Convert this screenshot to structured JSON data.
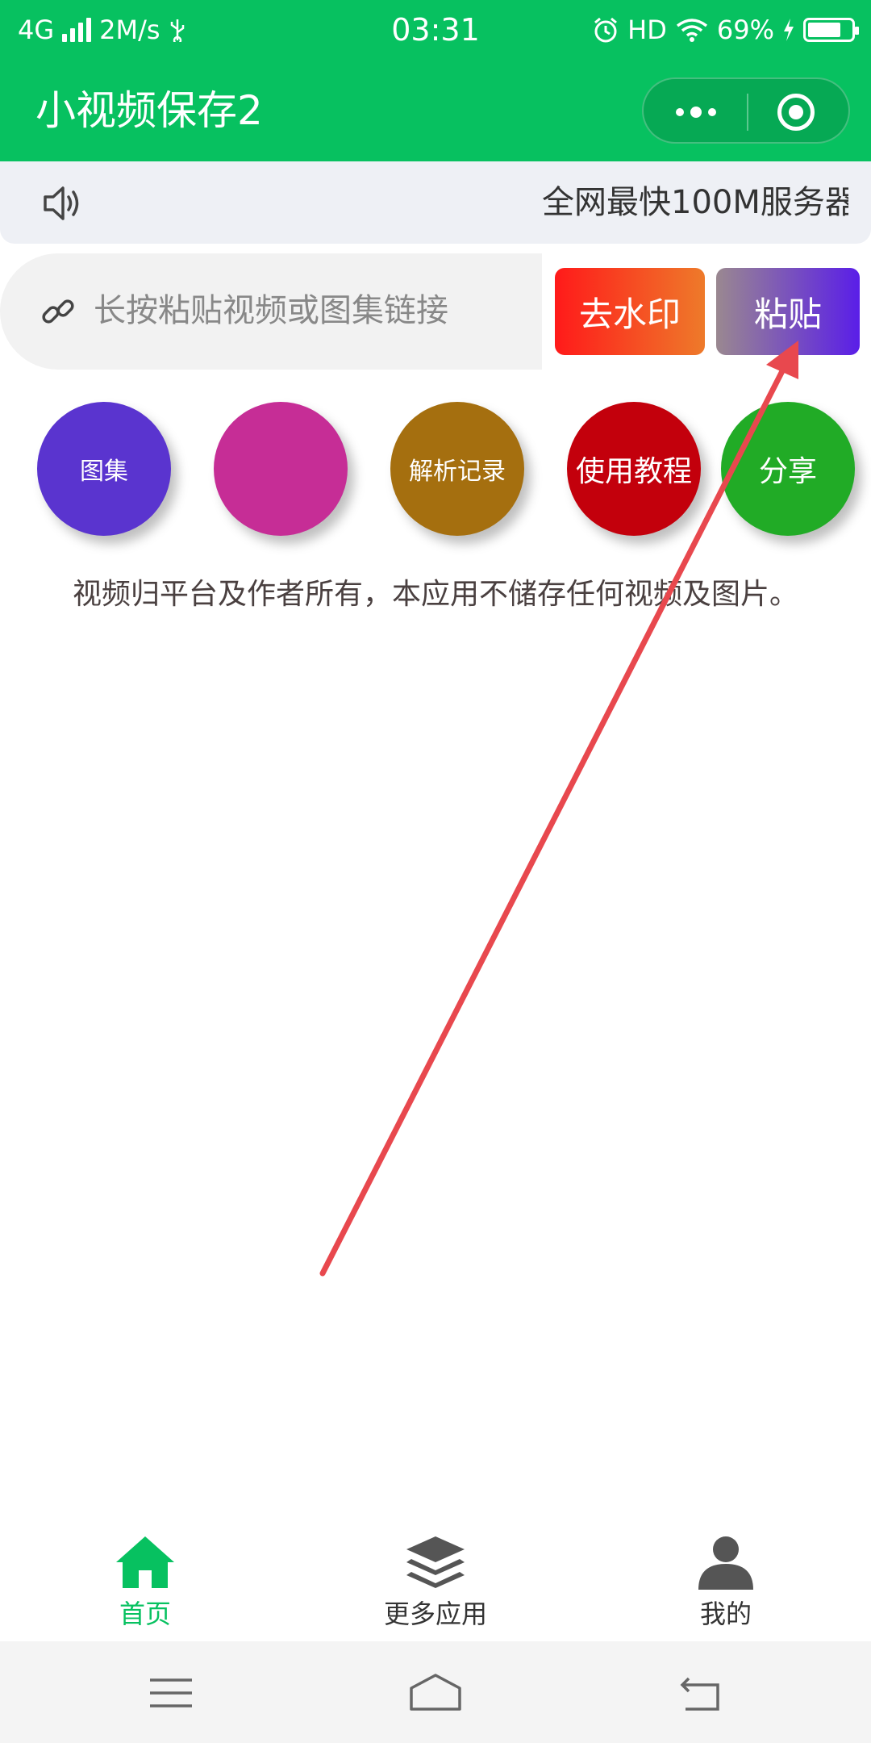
{
  "status_bar": {
    "network": "4G",
    "speed": "2M/s",
    "time": "03:31",
    "hd": "HD",
    "battery": "69%"
  },
  "title_bar": {
    "title": "小视频保存2",
    "more_icon": "more-dots-icon",
    "close_icon": "target-icon"
  },
  "notice": {
    "icon": "speaker-icon",
    "text": "全网最快100M服务器"
  },
  "input": {
    "icon": "link-icon",
    "placeholder": "长按粘贴视频或图集链接"
  },
  "buttons": {
    "remove_watermark": "去水印",
    "paste": "粘贴"
  },
  "circles": [
    {
      "label": "图集",
      "color": "#5a34cf"
    },
    {
      "label": "",
      "color": "#c62d96"
    },
    {
      "label": "解析记录",
      "color": "#a56f0f"
    },
    {
      "label": "使用教程",
      "color": "#c3000c"
    },
    {
      "label": "分享",
      "color": "#21ab26"
    }
  ],
  "disclaimer": "视频归平台及作者所有，本应用不储存任何视频及图片。",
  "tabbar": [
    {
      "label": "首页",
      "icon": "home-icon",
      "active": true
    },
    {
      "label": "更多应用",
      "icon": "layers-icon",
      "active": false
    },
    {
      "label": "我的",
      "icon": "user-icon",
      "active": false
    }
  ],
  "colors": {
    "brand": "#07c160",
    "annotation_arrow": "#e8484e"
  }
}
